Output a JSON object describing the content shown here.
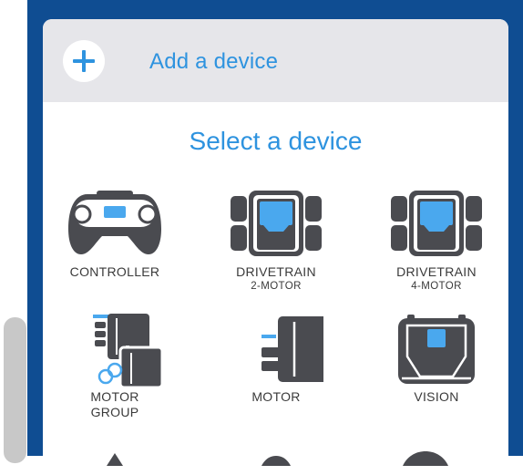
{
  "add_bar": {
    "label": "Add a device",
    "icon": "plus-icon"
  },
  "title": "Select a device",
  "devices": [
    {
      "label": "CONTROLLER",
      "sub": "",
      "icon": "controller-icon"
    },
    {
      "label": "DRIVETRAIN",
      "sub": "2-MOTOR",
      "icon": "drivetrain-2-motor-icon"
    },
    {
      "label": "DRIVETRAIN",
      "sub": "4-MOTOR",
      "icon": "drivetrain-4-motor-icon"
    },
    {
      "label": "MOTOR",
      "sub": "GROUP",
      "icon": "motor-group-icon"
    },
    {
      "label": "MOTOR",
      "sub": "",
      "icon": "motor-icon"
    },
    {
      "label": "VISION",
      "sub": "",
      "icon": "vision-icon"
    }
  ],
  "colors": {
    "accent": "#2e93df",
    "frame": "#0f4d92",
    "icon_dark": "#4a4b50",
    "icon_blue": "#4aa8ee",
    "header_bg": "#e6e6ea"
  }
}
